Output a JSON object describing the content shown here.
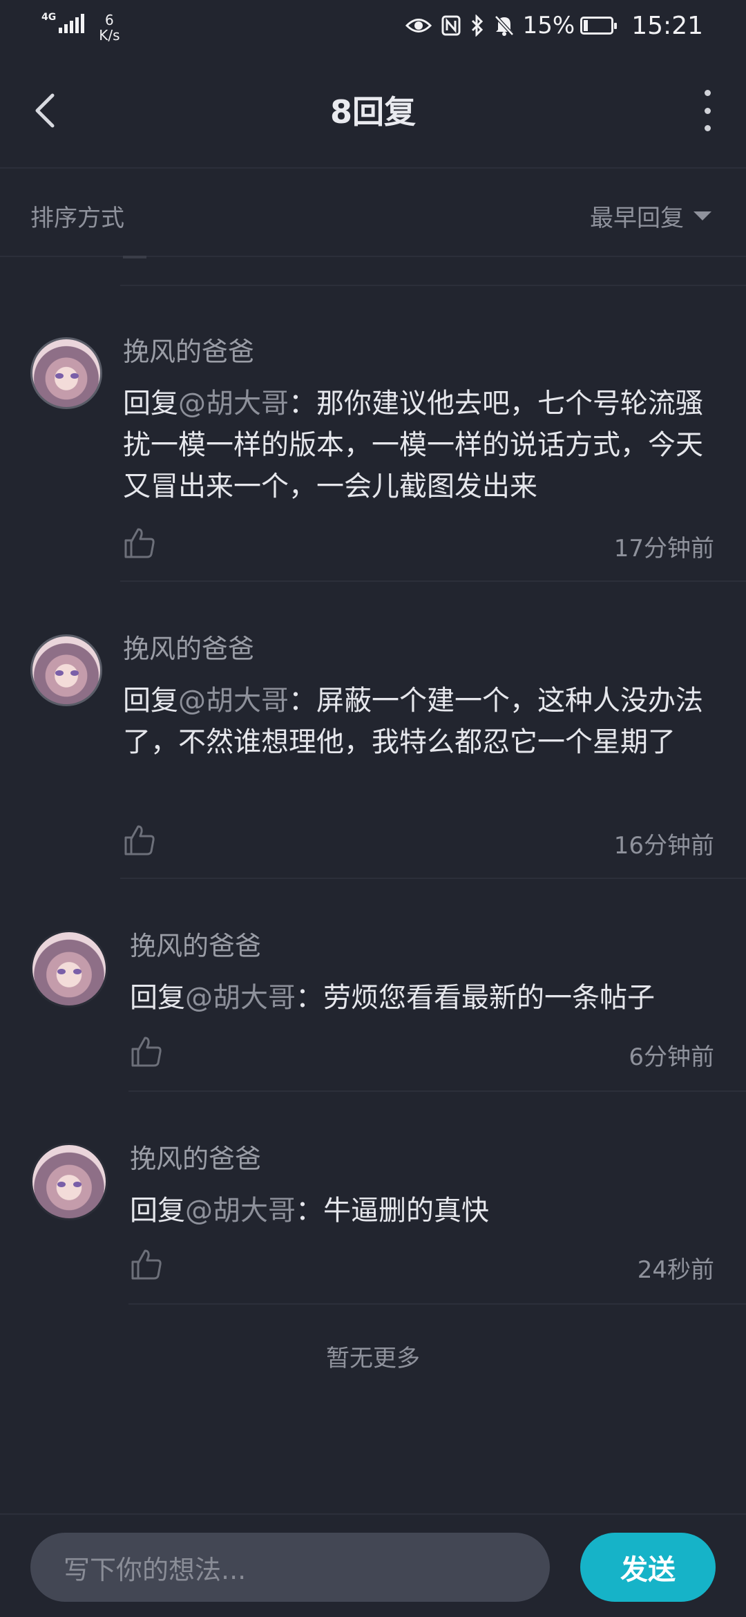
{
  "status_bar": {
    "network_type": "4G",
    "net_speed_value": "6",
    "net_speed_unit": "K/s",
    "battery_percent": "15%",
    "time": "15:21"
  },
  "header": {
    "title": "8回复"
  },
  "sort": {
    "label": "排序方式",
    "selected": "最早回复"
  },
  "comments": [
    {
      "username": "挽风的爸爸",
      "reply_prefix": "回复",
      "mention": "@胡大哥",
      "text": "：那你建议他去吧，七个号轮流骚扰一模一样的版本，一模一样的说话方式，今天又冒出来一个，一会儿截图发出来",
      "time": "17分钟前"
    },
    {
      "username": "挽风的爸爸",
      "reply_prefix": "回复",
      "mention": "@胡大哥",
      "text": "：屏蔽一个建一个，这种人没办法了，不然谁想理他，我特么都忍它一个星期了",
      "time": "16分钟前"
    },
    {
      "username": "挽风的爸爸",
      "reply_prefix": "回复",
      "mention": "@胡大哥",
      "text": "：劳烦您看看最新的一条帖子",
      "time": "6分钟前"
    },
    {
      "username": "挽风的爸爸",
      "reply_prefix": "回复",
      "mention": "@胡大哥",
      "text": "：牛逼删的真快",
      "time": "24秒前"
    }
  ],
  "footer_text": "暂无更多",
  "composer": {
    "placeholder": "写下你的想法...",
    "send_label": "发送"
  },
  "colors": {
    "background": "#22252f",
    "accent": "#16b3c8",
    "muted_text": "#8f929c",
    "input_bg": "#434754"
  }
}
